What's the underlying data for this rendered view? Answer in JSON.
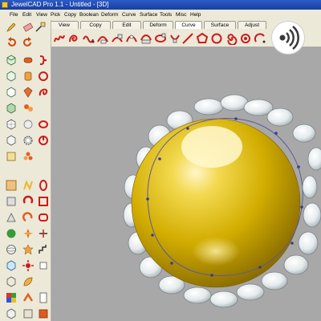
{
  "window": {
    "title": "JewelCAD Pro 1.1 - Untitled - [3D]"
  },
  "menu": [
    "File",
    "Edit",
    "View",
    "Pick",
    "Copy",
    "Boolean",
    "Deform",
    "Curve",
    "Surface",
    "Tools",
    "Misc",
    "Help"
  ],
  "tabs": [
    {
      "label": "View"
    },
    {
      "label": "Copy"
    },
    {
      "label": "Edit"
    },
    {
      "label": "Deform"
    },
    {
      "label": "Curve",
      "active": true
    },
    {
      "label": "Surface"
    },
    {
      "label": "Adjust"
    }
  ],
  "viewport": {
    "object": "gold-sphere-with-diamond-crown",
    "colors": {
      "background": "#a8a8a8",
      "gold": "#d8b800",
      "curve": "#5a5aa0"
    }
  },
  "overlay": {
    "icon": "podcast-icon"
  }
}
